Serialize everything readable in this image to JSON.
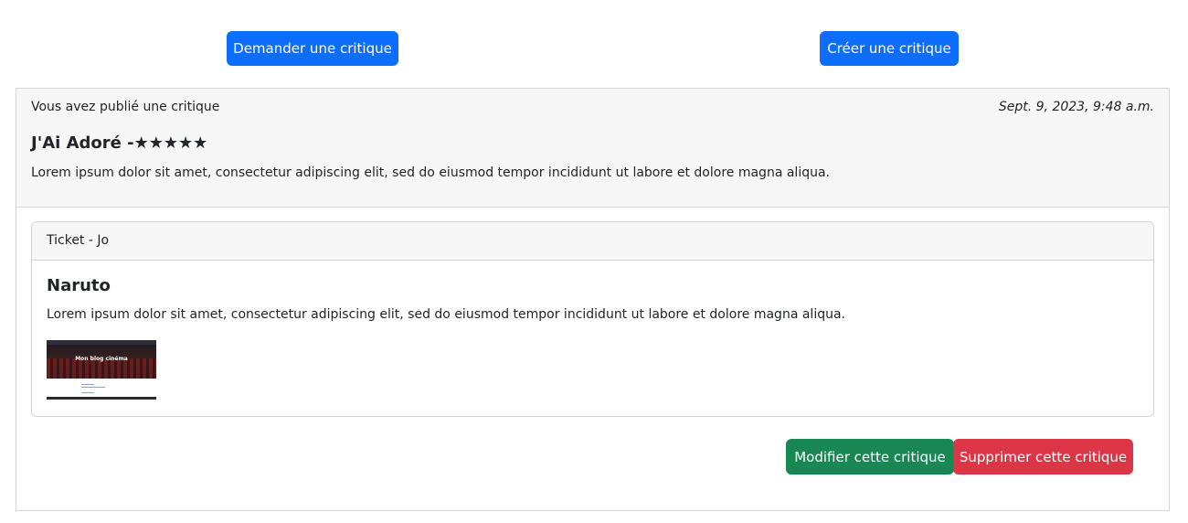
{
  "top_actions": {
    "request_review_label": "Demander une critique",
    "create_review_label": "Créer une critique"
  },
  "review": {
    "meta": "Vous avez publié une critique",
    "date": "Sept. 9, 2023, 9:48 a.m.",
    "title": "J'Ai Adoré -★★★★★",
    "body": "Lorem ipsum dolor sit amet, consectetur adipiscing elit, sed do eiusmod tempor incididunt ut labore et dolore magna aliqua.",
    "rating": 5,
    "rating_max": 5
  },
  "ticket": {
    "header": "Ticket - Jo",
    "title": "Naruto",
    "body": "Lorem ipsum dolor sit amet, consectetur adipiscing elit, sed do eiusmod tempor incididunt ut labore et dolore magna aliqua.",
    "image_caption": "Mon blog cinéma"
  },
  "review_actions": {
    "modify_label": "Modifier cette critique",
    "delete_label": "Supprimer cette critique"
  },
  "colors": {
    "primary": "#0d6efd",
    "success": "#198754",
    "danger": "#dc3545",
    "card_header_bg": "#f7f7f7",
    "border": "#d6d6d6"
  }
}
